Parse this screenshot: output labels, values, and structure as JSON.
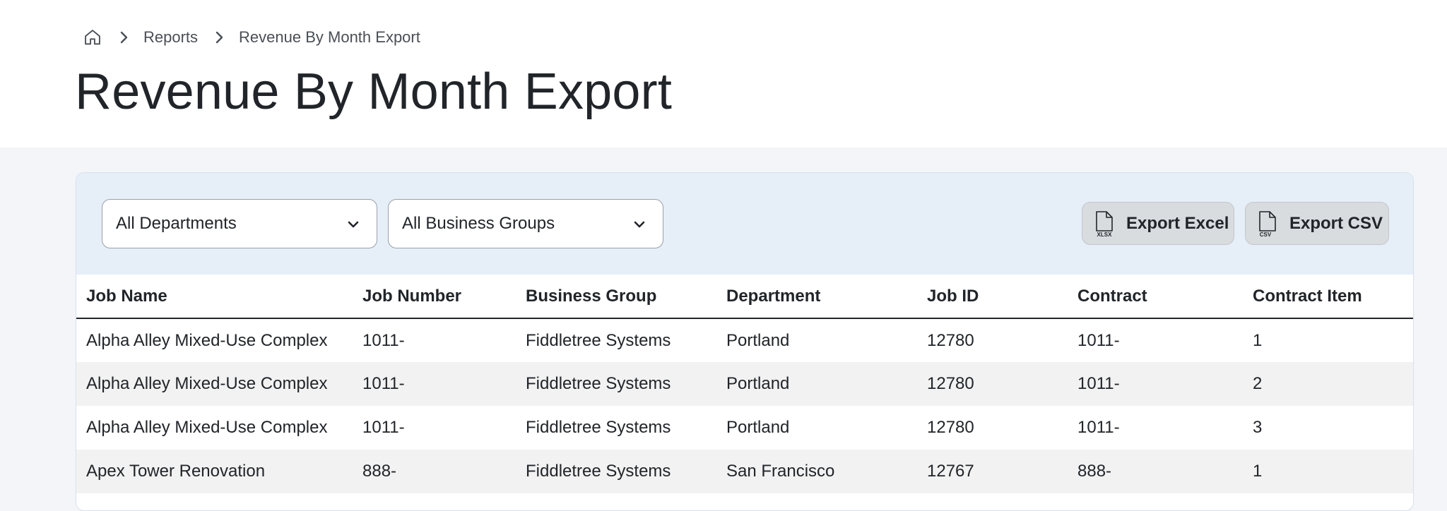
{
  "breadcrumb": {
    "items": [
      "Reports",
      "Revenue By Month Export"
    ]
  },
  "page": {
    "title": "Revenue By Month Export"
  },
  "filters": {
    "department": "All Departments",
    "business_group": "All Business Groups"
  },
  "actions": {
    "export_excel": "Export Excel",
    "export_excel_icon_text": "XLSX",
    "export_csv": "Export CSV",
    "export_csv_icon_text": "CSV"
  },
  "table": {
    "columns": [
      "Job Name",
      "Job Number",
      "Business Group",
      "Department",
      "Job ID",
      "Contract",
      "Contract Item"
    ],
    "rows": [
      [
        "Alpha Alley Mixed-Use Complex",
        "1011-",
        "Fiddletree Systems",
        "Portland",
        "12780",
        "1011-",
        "1"
      ],
      [
        "Alpha Alley Mixed-Use Complex",
        "1011-",
        "Fiddletree Systems",
        "Portland",
        "12780",
        "1011-",
        "2"
      ],
      [
        "Alpha Alley Mixed-Use Complex",
        "1011-",
        "Fiddletree Systems",
        "Portland",
        "12780",
        "1011-",
        "3"
      ],
      [
        "Apex Tower Renovation",
        "888-",
        "Fiddletree Systems",
        "San Francisco",
        "12767",
        "888-",
        "1"
      ]
    ]
  },
  "icons": {
    "home": "home-icon",
    "separator": "chevron-right-icon",
    "dropdown": "chevron-down-icon",
    "excel": "xlsx-file-icon",
    "csv": "csv-file-icon"
  }
}
